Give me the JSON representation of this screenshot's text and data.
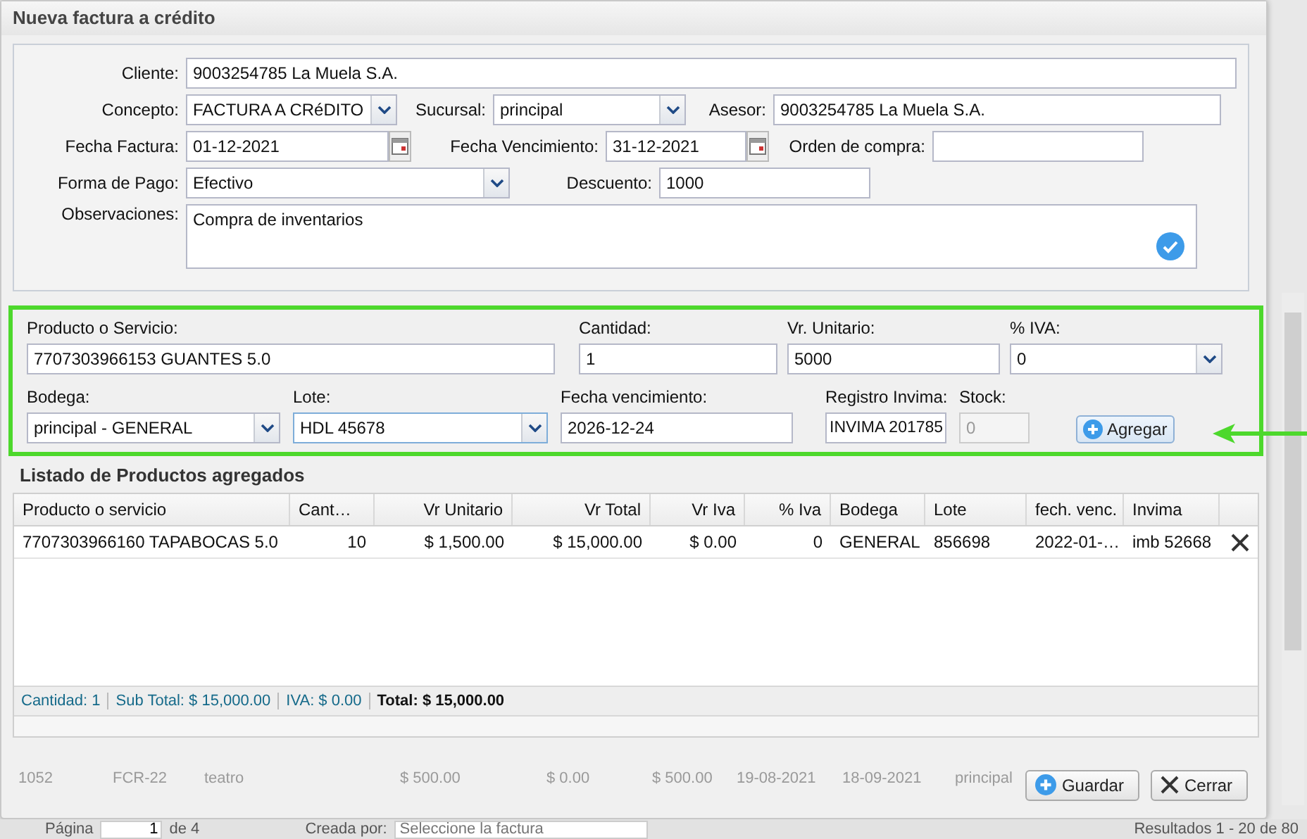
{
  "dialog": {
    "title": "Nueva factura a crédito"
  },
  "form": {
    "cliente": {
      "label": "Cliente:",
      "value": "9003254785 La Muela S.A."
    },
    "concepto": {
      "label": "Concepto:",
      "value": "FACTURA A CRéDITO"
    },
    "sucursal": {
      "label": "Sucursal:",
      "value": "principal"
    },
    "asesor": {
      "label": "Asesor:",
      "value": "9003254785 La Muela S.A."
    },
    "fecha_factura": {
      "label": "Fecha Factura:",
      "value": "01-12-2021"
    },
    "fecha_vencimiento": {
      "label": "Fecha Vencimiento:",
      "value": "31-12-2021"
    },
    "orden_compra": {
      "label": "Orden de compra:"
    },
    "forma_pago": {
      "label": "Forma de Pago:",
      "value": "Efectivo"
    },
    "descuento": {
      "label": "Descuento:",
      "value": "1000"
    },
    "observaciones": {
      "label": "Observaciones:",
      "value": "Compra de inventarios"
    }
  },
  "product_entry": {
    "highlighted": true,
    "producto": {
      "label": "Producto o Servicio:",
      "value": "7707303966153 GUANTES 5.0"
    },
    "cantidad": {
      "label": "Cantidad:",
      "value": "1"
    },
    "vr_unitario": {
      "label": "Vr. Unitario:",
      "value": "5000"
    },
    "iva": {
      "label": "% IVA:",
      "value": "0"
    },
    "bodega": {
      "label": "Bodega:",
      "value": "principal - GENERAL"
    },
    "lote": {
      "label": "Lote:",
      "value": "HDL 45678",
      "focused": true
    },
    "fecha_vencimiento": {
      "label": "Fecha vencimiento:",
      "value": "2026-12-24"
    },
    "registro_invima": {
      "label": "Registro Invima:",
      "value": "INVIMA 201785"
    },
    "stock": {
      "label": "Stock:",
      "value": "0",
      "disabled": true
    },
    "add_button": "Agregar"
  },
  "products": {
    "title": "Listado de Productos agregados",
    "columns": [
      "Producto o servicio",
      "Cant…",
      "Vr Unitario",
      "Vr Total",
      "Vr Iva",
      "% Iva",
      "Bodega",
      "Lote",
      "fech. venc.",
      "Invima"
    ],
    "rows": [
      [
        "7707303966160 TAPABOCAS 5.0",
        "10",
        "$ 1,500.00",
        "$ 15,000.00",
        "$ 0.00",
        "0",
        "GENERAL",
        "856698",
        "2022-01-…",
        "imb 52668"
      ]
    ],
    "summary": [
      {
        "text": "Cantidad: 1",
        "kind": "subtotal"
      },
      {
        "text": "Sub Total: $ 15,000.00",
        "kind": "subtotal"
      },
      {
        "text": "IVA: $ 0.00",
        "kind": "subtotal"
      },
      {
        "text": "Total: $ 15,000.00",
        "kind": "total"
      }
    ]
  },
  "background_row": [
    "1052",
    "FCR-22",
    "teatro",
    "$ 500.00",
    "$ 0.00",
    "$ 500.00",
    "19-08-2021",
    "18-09-2021",
    "principal"
  ],
  "buttons": [
    {
      "label": "Guardar",
      "kind": "save"
    },
    {
      "label": "Cerrar",
      "kind": "close"
    }
  ],
  "pager": {
    "page_label": "Página",
    "page_value": "1",
    "of_label": "de 4",
    "created_by_label": "Creada por:",
    "created_by_placeholder": "Seleccione la factura",
    "results": "Resultados 1 - 20 de 80"
  }
}
